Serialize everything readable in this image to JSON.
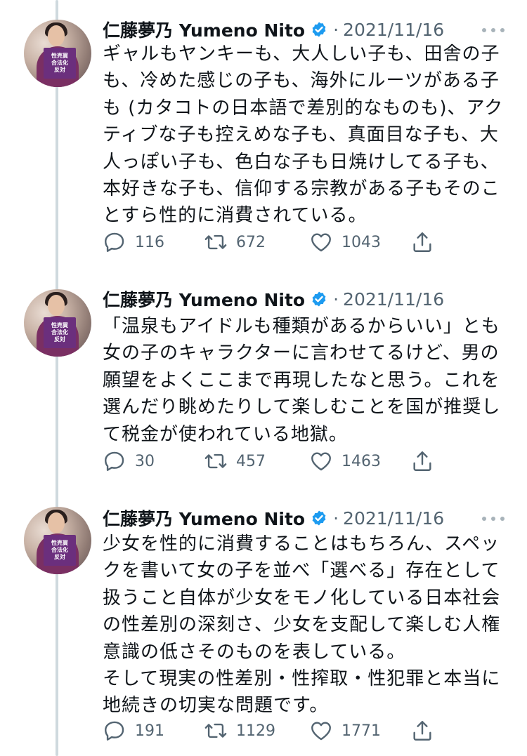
{
  "tweets": [
    {
      "author": "仁藤夢乃 Yumeno Nito",
      "date": "2021/11/16",
      "separator": "·",
      "text": "ギャルもヤンキーも、大人しい子も、田舎の子\nも、冷めた感じの子も、海外にルーツがある子\nも (カタコトの日本語で差別的なものも)、アク\nティブな子も控えめな子も、真面目な子も、大\n人っぽい子も、色白な子も日焼けしてる子も、\n本好きな子も、信仰する宗教がある子もそのこ\nとすら性的に消費されている。",
      "replies": "116",
      "retweets": "672",
      "likes": "1043"
    },
    {
      "author": "仁藤夢乃 Yumeno Nito",
      "date": "2021/11/16",
      "separator": "·",
      "text": "「温泉もアイドルも種類があるからいい」とも\n女の子のキャラクターに言わせてるけど、男の\n願望をよくここまで再現したなと思う。これを\n選んだり眺めたりして楽しむことを国が推奨し\nて税金が使われている地獄。",
      "replies": "30",
      "retweets": "457",
      "likes": "1463"
    },
    {
      "author": "仁藤夢乃 Yumeno Nito",
      "date": "2021/11/16",
      "separator": "·",
      "text": "少女を性的に消費することはもちろん、スペッ\nクを書いて女の子を並べ「選べる」存在として\n扱うこと自体が少女をモノ化している日本社会\nの性差別の深刻さ、少女を支配して楽しむ人権\n意識の低さそのものを表している。\nそして現実の性差別・性搾取・性犯罪と本当に\n地続きの切実な問題です。",
      "replies": "191",
      "retweets": "1129",
      "likes": "1771"
    }
  ],
  "avatar_sign_lines": [
    "性売買",
    "合法化",
    "反対"
  ],
  "colors": {
    "text": "#0f1419",
    "secondary": "#536471",
    "verified": "#1d9bf0",
    "thread_line": "#cfd9de"
  },
  "icons": [
    "reply-icon",
    "retweet-icon",
    "like-icon",
    "share-icon",
    "verified-badge-icon",
    "more-icon"
  ]
}
